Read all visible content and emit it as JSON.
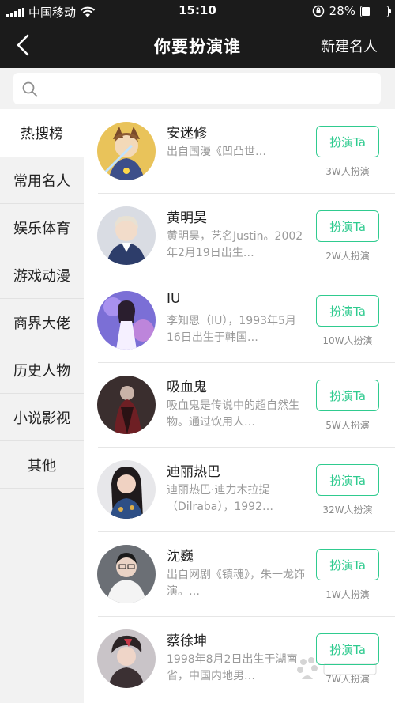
{
  "status_bar": {
    "carrier": "中国移动",
    "time": "15:10",
    "battery": "28%",
    "battery_level": 0.28
  },
  "nav": {
    "title": "你要扮演谁",
    "new_button": "新建名人"
  },
  "search": {
    "placeholder": "",
    "value": ""
  },
  "sidebar": {
    "items": [
      {
        "label": "热搜榜",
        "active": true
      },
      {
        "label": "常用名人"
      },
      {
        "label": "娱乐体育"
      },
      {
        "label": "游戏动漫"
      },
      {
        "label": "商界大佬"
      },
      {
        "label": "历史人物"
      },
      {
        "label": "小说影视"
      },
      {
        "label": "其他"
      }
    ]
  },
  "list": {
    "items": [
      {
        "name": "安迷修",
        "desc": "出自国漫《凹凸世…",
        "action": "扮演Ta",
        "count": "3W人扮演"
      },
      {
        "name": "黄明昊",
        "desc": "黄明昊，艺名Justin。2002年2月19日出生…",
        "action": "扮演Ta",
        "count": "2W人扮演"
      },
      {
        "name": "IU",
        "desc": "李知恩（IU），1993年5月16日出生于韩国…",
        "action": "扮演Ta",
        "count": "10W人扮演"
      },
      {
        "name": "吸血鬼",
        "desc": "吸血鬼是传说中的超自然生物。通过饮用人…",
        "action": "扮演Ta",
        "count": "5W人扮演"
      },
      {
        "name": "迪丽热巴",
        "desc": "迪丽热巴·迪力木拉提（Dilraba），1992…",
        "action": "扮演Ta",
        "count": "32W人扮演"
      },
      {
        "name": "沈巍",
        "desc": "出自网剧《镇魂》，朱一龙饰演。…",
        "action": "扮演Ta",
        "count": "1W人扮演"
      },
      {
        "name": "蔡徐坤",
        "desc": "1998年8月2日出生于湖南省，中国内地男…",
        "action": "扮演Ta",
        "count": "7W人扮演"
      }
    ]
  },
  "colors": {
    "accent": "#2fcb8f",
    "header_bg": "#1b1b1b",
    "sidebar_bg": "#f2f2f2"
  },
  "icons": {
    "back": "chevron-left-icon",
    "search": "search-icon",
    "wifi": "wifi-icon",
    "lock": "rotation-lock-icon"
  }
}
